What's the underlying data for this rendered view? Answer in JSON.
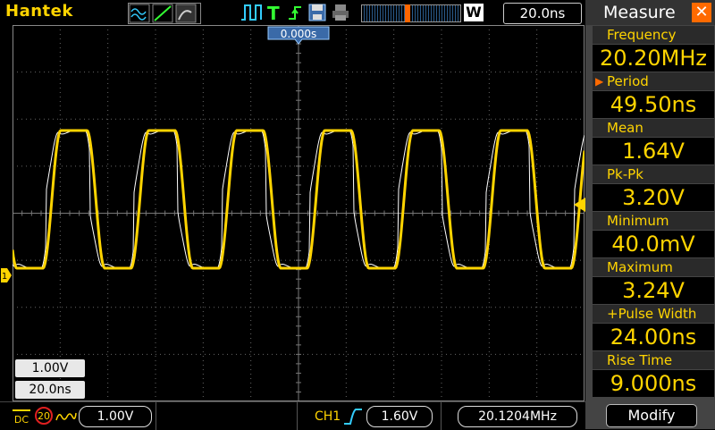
{
  "header": {
    "brand": "Hantek",
    "timebase_display": "20.0ns",
    "w_label": "W",
    "trigger_position": "0.000s"
  },
  "icons": [
    "waveform-icon",
    "run-icon",
    "trigger-t-icon",
    "save-icon",
    "print-icon",
    "memory-strip-icon",
    "trigger-level-marker-icon",
    "channel1-marker-icon"
  ],
  "scale_boxes": {
    "volts_div": "1.00V",
    "time_div": "20.0ns"
  },
  "bottom": {
    "coupling": "DC",
    "bw_limit": "20",
    "ch1_scale": "1.00V",
    "trig_channel": "CH1",
    "trig_level": "1.60V",
    "frequency_readout": "20.1204MHz"
  },
  "measure": {
    "title": "Measure",
    "items": [
      {
        "label": "Frequency",
        "value": "20.20MHz"
      },
      {
        "label": "Period",
        "value": "49.50ns"
      },
      {
        "label": "Mean",
        "value": "1.64V"
      },
      {
        "label": "Pk-Pk",
        "value": "3.20V"
      },
      {
        "label": "Minimum",
        "value": "40.0mV"
      },
      {
        "label": "Maximum",
        "value": "3.24V"
      },
      {
        "label": "+Pulse Width",
        "value": "24.00ns"
      },
      {
        "label": "Rise Time",
        "value": "9.000ns"
      }
    ],
    "modify_label": "Modify"
  },
  "colors": {
    "accent": "#ffd400",
    "close": "#ff6a00",
    "grid": "#888888"
  }
}
